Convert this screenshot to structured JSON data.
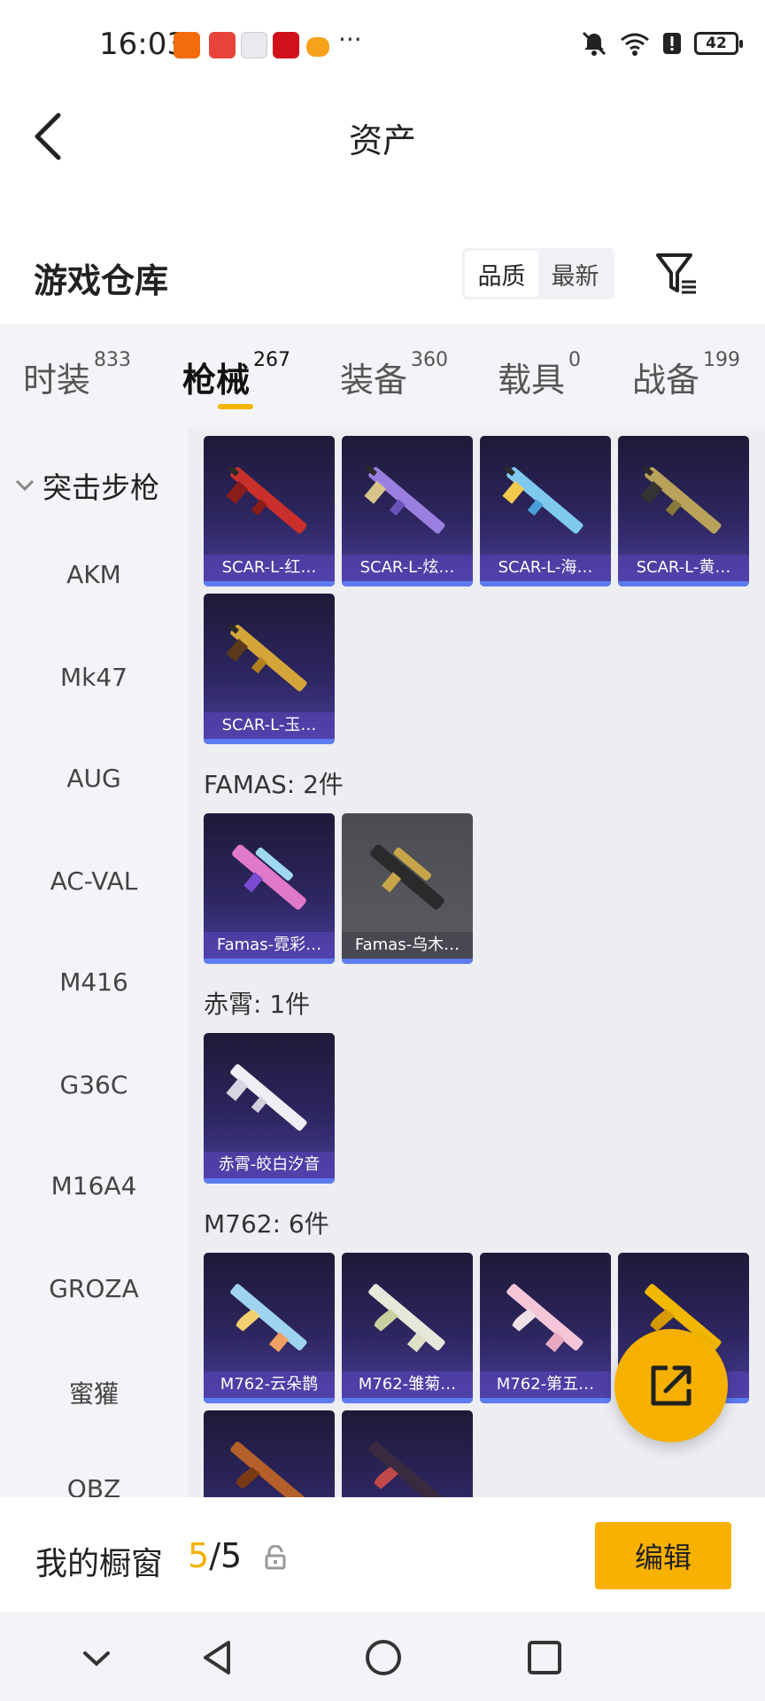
{
  "status_bar": {
    "time": "16:03",
    "battery": "42",
    "more": "···"
  },
  "header": {
    "title": "资产"
  },
  "warehouse": {
    "title": "游戏仓库",
    "sort_options": [
      "品质",
      "最新"
    ],
    "active_sort": "品质"
  },
  "tabs": [
    {
      "label": "时装",
      "count": "833"
    },
    {
      "label": "枪械",
      "count": "267"
    },
    {
      "label": "装备",
      "count": "360"
    },
    {
      "label": "载具",
      "count": "0"
    },
    {
      "label": "战备",
      "count": "199"
    }
  ],
  "sidebar": {
    "category": "突击步枪",
    "items": [
      "AKM",
      "Mk47",
      "AUG",
      "AC-VAL",
      "M416",
      "G36C",
      "M16A4",
      "GROZA",
      "蜜獾",
      "QBZ"
    ]
  },
  "groups": [
    {
      "title": "",
      "items": [
        "SCAR-L-红…",
        "SCAR-L-炫…",
        "SCAR-L-海…",
        "SCAR-L-黄…",
        "SCAR-L-玉…"
      ]
    },
    {
      "title": "FAMAS: 2件",
      "items": [
        "Famas-霓彩…",
        "Famas-乌木…"
      ]
    },
    {
      "title": "赤霄: 1件",
      "items": [
        "赤霄-皎白汐音"
      ]
    },
    {
      "title": "M762: 6件",
      "items": [
        "M762-云朵鹊",
        "M762-雏菊…",
        "M762-第五…",
        "M762-…",
        "",
        ""
      ]
    }
  ],
  "showcase": {
    "label": "我的橱窗",
    "current": "5",
    "total": "/5",
    "edit_label": "编辑"
  },
  "colors": {
    "accent": "#f5b400",
    "card_bg": "#2d2660",
    "sidebar_bg": "#f3f4f7"
  }
}
